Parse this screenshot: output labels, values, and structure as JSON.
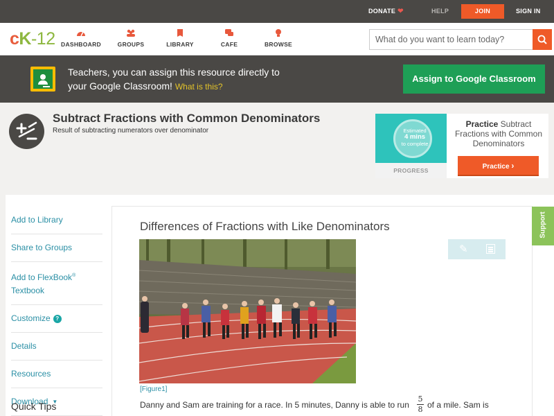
{
  "topbar": {
    "donate": "DONATE",
    "help": "HELP",
    "join": "JOIN",
    "signin": "SIGN IN"
  },
  "logo": {
    "c": "c",
    "k": "K",
    "dash": "-",
    "n": "12"
  },
  "nav": [
    {
      "label": "DASHBOARD",
      "icon": "dashboard-icon"
    },
    {
      "label": "GROUPS",
      "icon": "groups-icon"
    },
    {
      "label": "LIBRARY",
      "icon": "library-icon"
    },
    {
      "label": "CAFE",
      "icon": "cafe-icon"
    },
    {
      "label": "BROWSE",
      "icon": "browse-icon"
    }
  ],
  "search": {
    "placeholder": "What do you want to learn today?"
  },
  "classroom": {
    "line1": "Teachers, you can assign this resource directly to",
    "line2": "your Google Classroom!",
    "what": "What is this?",
    "button": "Assign to Google Classroom"
  },
  "concept": {
    "title": "Subtract Fractions with Common Denominators",
    "subtitle": "Result of subtracting numerators over denominator"
  },
  "practice_card": {
    "estimated": "Estimated",
    "mins": "4 mins",
    "to_complete": "to complete",
    "progress": "PROGRESS",
    "practice_bold": "Practice",
    "practice_rest": "Subtract Fractions with Common Denominators",
    "button": "Practice"
  },
  "sidebar": {
    "items": [
      {
        "label": "Add to Library"
      },
      {
        "label": "Share to Groups"
      },
      {
        "label": "Add to FlexBook",
        "sup": "®",
        "line2": "Textbook"
      },
      {
        "label": "Customize"
      },
      {
        "label": "Details"
      },
      {
        "label": "Resources"
      },
      {
        "label": "Download"
      }
    ],
    "help_badge": "?",
    "quick_tips": "Quick Tips"
  },
  "article": {
    "title": "Differences of Fractions with Like Denominators",
    "caption": "[Figure1]",
    "text_before": "Danny and Sam are training for a race. In 5 minutes, Danny is able to run",
    "frac_num": "5",
    "frac_den": "8",
    "text_after": "of a mile. Sam is"
  },
  "support": "Support",
  "colors": {
    "accent": "#ef5a28",
    "teal": "#2ec3bb",
    "green": "#1e9f56",
    "link": "#2a8fa5",
    "dark": "#4a4845"
  }
}
